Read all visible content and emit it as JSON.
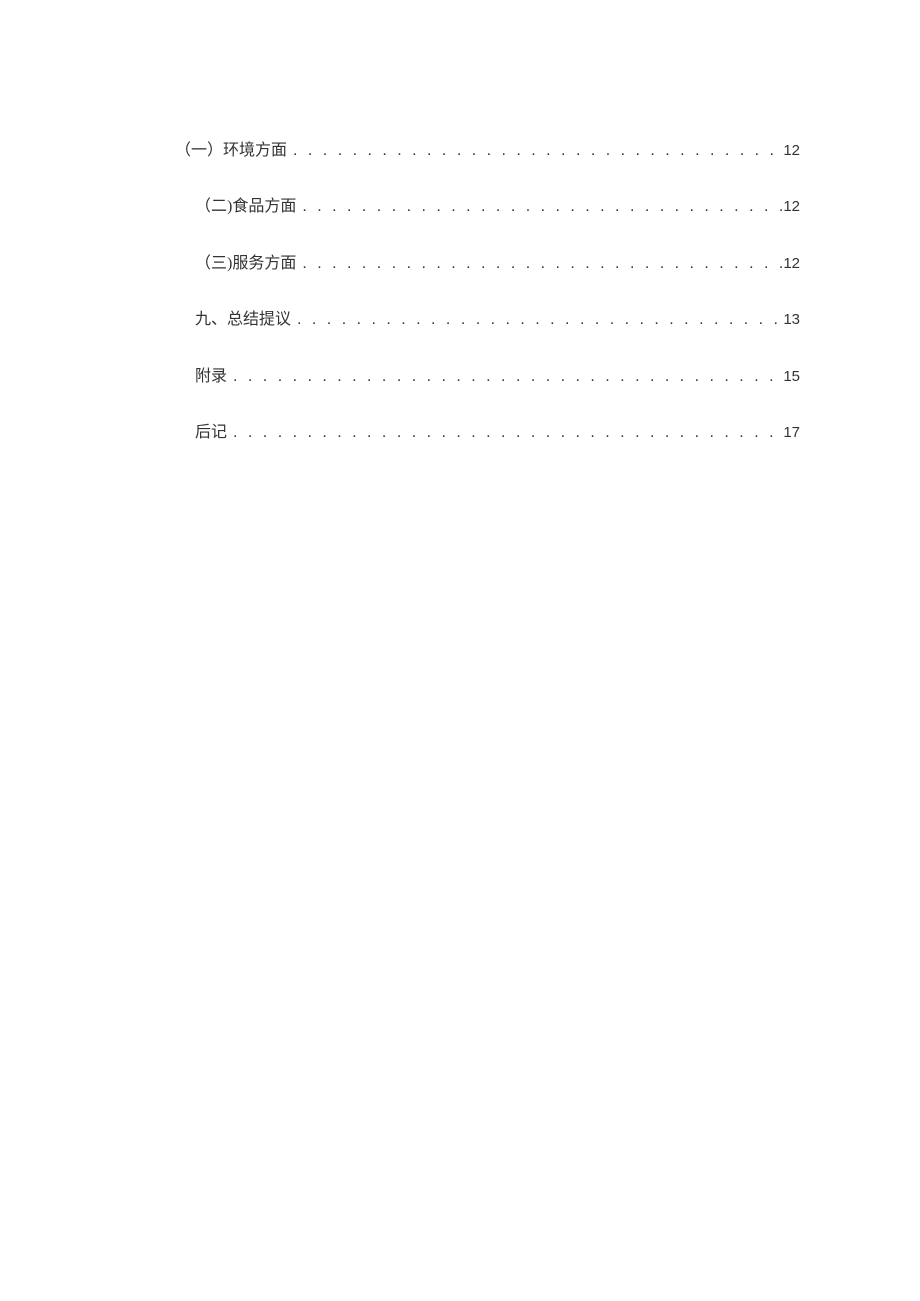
{
  "toc": {
    "entries": [
      {
        "label": "（一）环境方面",
        "page": "12",
        "indent": 0
      },
      {
        "label": "（二)食品方面",
        "page": "12",
        "indent": 1
      },
      {
        "label": "（三)服务方面",
        "page": "12",
        "indent": 1
      },
      {
        "label": "九、总结提议",
        "page": "13",
        "indent": 1
      },
      {
        "label": "附录",
        "page": "15",
        "indent": 1
      },
      {
        "label": "后记",
        "page": "17",
        "indent": 1
      }
    ]
  }
}
